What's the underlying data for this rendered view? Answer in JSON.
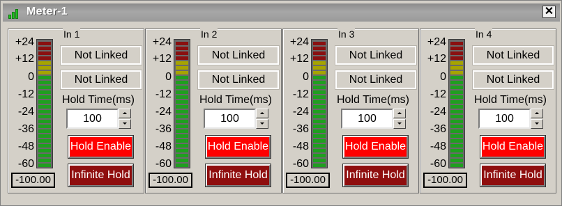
{
  "window": {
    "title": "Meter-1",
    "close_label": "✕"
  },
  "colors": {
    "meter_green": "#1f9f1f",
    "meter_yellow": "#a6a400",
    "meter_red": "#8a1010",
    "hold_enable_bg": "#ff0000",
    "infinite_hold_bg": "#8f0e0e"
  },
  "scale": [
    "+24",
    "+12",
    "0",
    "-12",
    "-24",
    "-36",
    "-48",
    "-60"
  ],
  "channels": [
    {
      "label": "In 1",
      "link1": "Not Linked",
      "link2": "Not Linked",
      "hold_label": "Hold Time(ms)",
      "hold_value": "100",
      "hold_enable": "Hold Enable",
      "infinite_hold": "Infinite Hold",
      "readout": "-100.00"
    },
    {
      "label": "In 2",
      "link1": "Not Linked",
      "link2": "Not Linked",
      "hold_label": "Hold Time(ms)",
      "hold_value": "100",
      "hold_enable": "Hold Enable",
      "infinite_hold": "Infinite Hold",
      "readout": "-100.00"
    },
    {
      "label": "In 3",
      "link1": "Not Linked",
      "link2": "Not Linked",
      "hold_label": "Hold Time(ms)",
      "hold_value": "100",
      "hold_enable": "Hold Enable",
      "infinite_hold": "Infinite Hold",
      "readout": "-100.00"
    },
    {
      "label": "In 4",
      "link1": "Not Linked",
      "link2": "Not Linked",
      "hold_label": "Hold Time(ms)",
      "hold_value": "100",
      "hold_enable": "Hold Enable",
      "infinite_hold": "Infinite Hold",
      "readout": "-100.00"
    }
  ]
}
